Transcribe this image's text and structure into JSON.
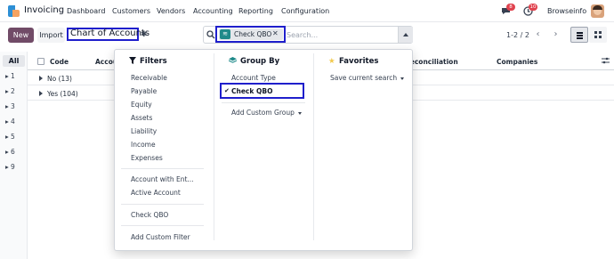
{
  "app": {
    "title": "Invoicing",
    "nav": [
      "Dashboard",
      "Customers",
      "Vendors",
      "Accounting",
      "Reporting",
      "Configuration"
    ],
    "chat_badge": "8",
    "activity_badge": "10",
    "company": "Browseinfo"
  },
  "control": {
    "new_label": "New",
    "import_label": "Import",
    "breadcrumb": "Chart of Accounts",
    "facet_label": "Check QBO",
    "search_placeholder": "Search...",
    "pager": "1-2 / 2"
  },
  "index": {
    "all_label": "All",
    "items": [
      "1",
      "2",
      "3",
      "4",
      "5",
      "6",
      "9"
    ]
  },
  "table": {
    "columns": [
      "Code",
      "Account",
      "Reconciliation",
      "Companies"
    ],
    "rows": [
      {
        "label": "No (13)"
      },
      {
        "label": "Yes (104)"
      }
    ]
  },
  "filters": {
    "heading": "Filters",
    "group1": [
      "Receivable",
      "Payable",
      "Equity",
      "Assets",
      "Liability",
      "Income",
      "Expenses"
    ],
    "group2": [
      "Account with Ent...",
      "Active Account"
    ],
    "group3": [
      "Check QBO"
    ],
    "custom": "Add Custom Filter"
  },
  "groupby": {
    "heading": "Group By",
    "items": [
      "Account Type",
      "Check QBO"
    ],
    "custom": "Add Custom Group"
  },
  "favorites": {
    "heading": "Favorites",
    "save": "Save current search"
  },
  "colors": {
    "brand": "#714b67",
    "highlight_box": "#1f1fcc",
    "filter_icon": "#111827",
    "groupby_icon": "#1f8a8a",
    "favorites_icon": "#f2c94c"
  }
}
